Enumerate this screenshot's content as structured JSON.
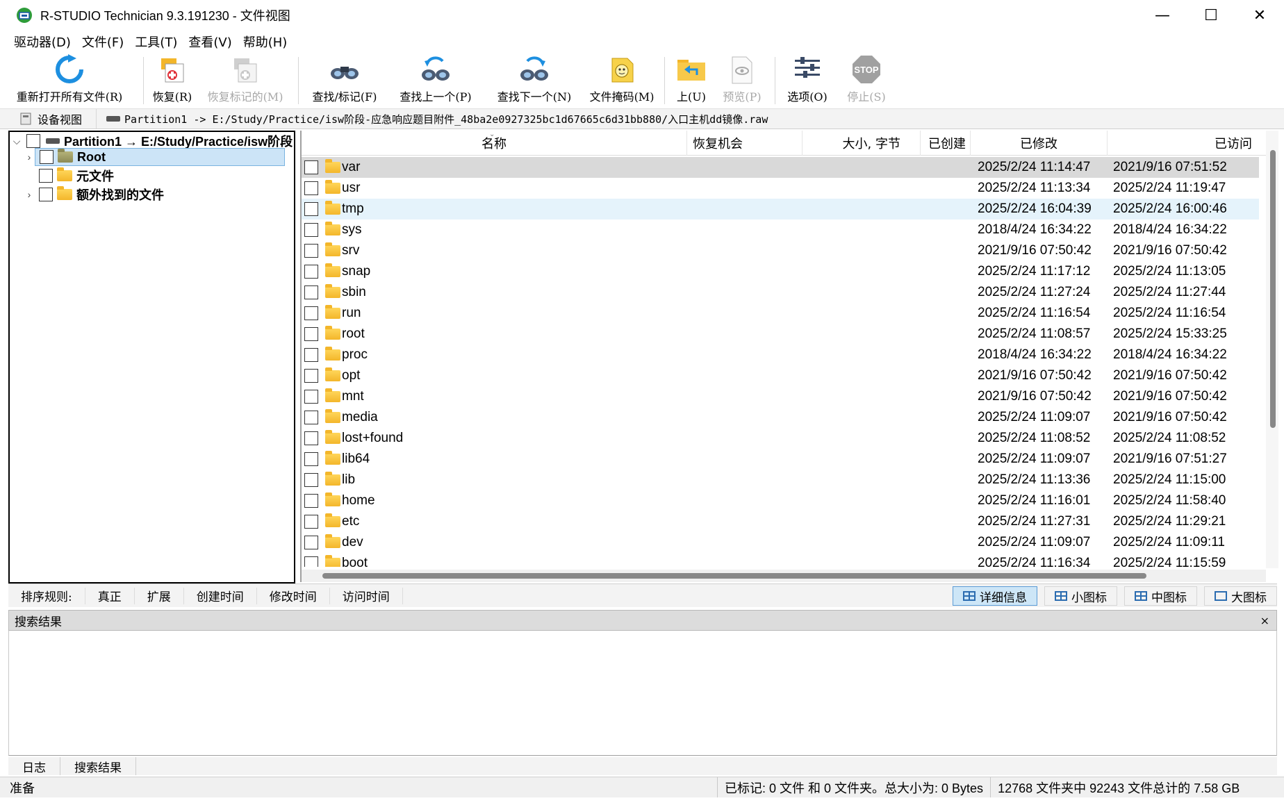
{
  "window": {
    "title": "R-STUDIO Technician 9.3.191230 - 文件视图",
    "minimize": "—",
    "maximize": "☐",
    "close": "✕"
  },
  "menu": [
    "驱动器(D)",
    "文件(F)",
    "工具(T)",
    "查看(V)",
    "帮助(H)"
  ],
  "toolbar": {
    "reopen": "重新打开所有文件(R)",
    "recover": "恢复(R)",
    "recover_marked": "恢复标记的(M)",
    "find_mark": "查找/标记(F)",
    "find_prev": "查找上一个(P)",
    "find_next": "查找下一个(N)",
    "file_mask": "文件掩码(M)",
    "up": "上(U)",
    "preview": "预览(P)",
    "options": "选项(O)",
    "stop": "停止(S)",
    "stop_sign": "STOP"
  },
  "pathbar": {
    "device_view": "设备视图",
    "path": "Partition1 -> E:/Study/Practice/isw阶段-应急响应题目附件_48ba2e0927325bc1d67665c6d31bb880/入口主机dd镜像.raw"
  },
  "tree": {
    "partition": "Partition1 → E:/Study/Practice/isw阶段",
    "root": "Root",
    "meta": "元文件",
    "extra": "额外找到的文件"
  },
  "columns": {
    "name": "名称",
    "recovery": "恢复机会",
    "size": "大小, 字节",
    "created": "已创建",
    "modified": "已修改",
    "accessed": "已访问"
  },
  "rows": [
    {
      "name": "var",
      "modified": "2025/2/24 11:14:47",
      "accessed": "2021/9/16 07:51:52"
    },
    {
      "name": "usr",
      "modified": "2025/2/24 11:13:34",
      "accessed": "2025/2/24 11:19:47"
    },
    {
      "name": "tmp",
      "modified": "2025/2/24 16:04:39",
      "accessed": "2025/2/24 16:00:46"
    },
    {
      "name": "sys",
      "modified": "2018/4/24 16:34:22",
      "accessed": "2018/4/24 16:34:22"
    },
    {
      "name": "srv",
      "modified": "2021/9/16 07:50:42",
      "accessed": "2021/9/16 07:50:42"
    },
    {
      "name": "snap",
      "modified": "2025/2/24 11:17:12",
      "accessed": "2025/2/24 11:13:05"
    },
    {
      "name": "sbin",
      "modified": "2025/2/24 11:27:24",
      "accessed": "2025/2/24 11:27:44"
    },
    {
      "name": "run",
      "modified": "2025/2/24 11:16:54",
      "accessed": "2025/2/24 11:16:54"
    },
    {
      "name": "root",
      "modified": "2025/2/24 11:08:57",
      "accessed": "2025/2/24 15:33:25"
    },
    {
      "name": "proc",
      "modified": "2018/4/24 16:34:22",
      "accessed": "2018/4/24 16:34:22"
    },
    {
      "name": "opt",
      "modified": "2021/9/16 07:50:42",
      "accessed": "2021/9/16 07:50:42"
    },
    {
      "name": "mnt",
      "modified": "2021/9/16 07:50:42",
      "accessed": "2021/9/16 07:50:42"
    },
    {
      "name": "media",
      "modified": "2025/2/24 11:09:07",
      "accessed": "2021/9/16 07:50:42"
    },
    {
      "name": "lost+found",
      "modified": "2025/2/24 11:08:52",
      "accessed": "2025/2/24 11:08:52"
    },
    {
      "name": "lib64",
      "modified": "2025/2/24 11:09:07",
      "accessed": "2021/9/16 07:51:27"
    },
    {
      "name": "lib",
      "modified": "2025/2/24 11:13:36",
      "accessed": "2025/2/24 11:15:00"
    },
    {
      "name": "home",
      "modified": "2025/2/24 11:16:01",
      "accessed": "2025/2/24 11:58:40"
    },
    {
      "name": "etc",
      "modified": "2025/2/24 11:27:31",
      "accessed": "2025/2/24 11:29:21"
    },
    {
      "name": "dev",
      "modified": "2025/2/24 11:09:07",
      "accessed": "2025/2/24 11:09:11"
    },
    {
      "name": "boot",
      "modified": "2025/2/24 11:16:34",
      "accessed": "2025/2/24 11:15:59"
    }
  ],
  "sortbar": {
    "label": "排序规则:",
    "items": [
      "真正",
      "扩展",
      "创建时间",
      "修改时间",
      "访问时间"
    ]
  },
  "views": {
    "details": "详细信息",
    "small": "小图标",
    "medium": "中图标",
    "large": "大图标"
  },
  "search": {
    "title": "搜索结果",
    "close": "×"
  },
  "bottom_tabs": [
    "日志",
    "搜索结果"
  ],
  "status": {
    "ready": "准备",
    "marked": "已标记: 0 文件 和 0 文件夹。总大小为: 0 Bytes",
    "totals": "12768 文件夹中 92243 文件总计的 7.58 GB"
  },
  "colors": {
    "selection": "#cce4f7",
    "row_selected": "#d9d9d9",
    "row_hover": "#e5f3fb",
    "folder": "#f3b62a"
  }
}
